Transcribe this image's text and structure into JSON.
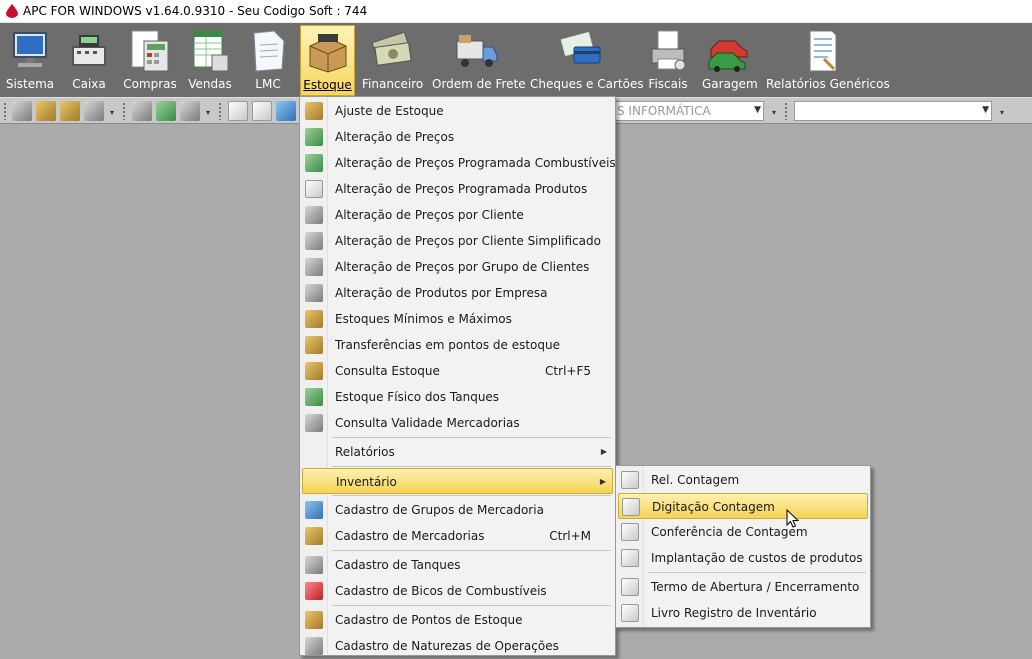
{
  "window": {
    "title": "APC FOR WINDOWS v1.64.0.9310 - Seu Codigo Soft : 744"
  },
  "menubar": {
    "items": [
      {
        "label": "Sistema",
        "icon": "monitor-icon"
      },
      {
        "label": "Caixa",
        "icon": "cash-register-icon"
      },
      {
        "label": "Compras",
        "icon": "calculator-icon"
      },
      {
        "label": "Vendas",
        "icon": "spreadsheet-icon"
      },
      {
        "label": "LMC",
        "icon": "document-icon"
      },
      {
        "label": "Estoque",
        "icon": "box-icon"
      },
      {
        "label": "Financeiro",
        "icon": "money-icon"
      },
      {
        "label": "Ordem de Frete",
        "icon": "truck-icon"
      },
      {
        "label": "Cheques e Cartões",
        "icon": "card-icon"
      },
      {
        "label": "Fiscais",
        "icon": "printer-icon"
      },
      {
        "label": "Garagem",
        "icon": "car-icon"
      },
      {
        "label": "Relatórios Genéricos",
        "icon": "report-icon"
      }
    ]
  },
  "toolbar2": {
    "combo1_text": "S INFORMÁTICA",
    "combo2_text": ""
  },
  "estoque_menu": {
    "items": [
      {
        "label": "Ajuste de Estoque",
        "shortcut": ""
      },
      {
        "label": "Alteração de Preços",
        "shortcut": ""
      },
      {
        "label": "Alteração de Preços Programada Combustíveis",
        "shortcut": ""
      },
      {
        "label": "Alteração de Preços Programada Produtos",
        "shortcut": ""
      },
      {
        "label": "Alteração de Preços por Cliente",
        "shortcut": ""
      },
      {
        "label": "Alteração de Preços por Cliente Simplificado",
        "shortcut": ""
      },
      {
        "label": "Alteração de Preços por Grupo de Clientes",
        "shortcut": ""
      },
      {
        "label": "Alteração de Produtos por Empresa",
        "shortcut": ""
      },
      {
        "label": "Estoques Mínimos e Máximos",
        "shortcut": ""
      },
      {
        "label": "Transferências em pontos de estoque",
        "shortcut": ""
      },
      {
        "label": "Consulta Estoque",
        "shortcut": "Ctrl+F5"
      },
      {
        "label": "Estoque Físico dos Tanques",
        "shortcut": ""
      },
      {
        "label": "Consulta Validade Mercadorias",
        "shortcut": ""
      },
      {
        "label": "Relatórios",
        "shortcut": ""
      },
      {
        "label": "Inventário",
        "shortcut": ""
      },
      {
        "label": "Cadastro de Grupos de Mercadoria",
        "shortcut": ""
      },
      {
        "label": "Cadastro de Mercadorias",
        "shortcut": "Ctrl+M"
      },
      {
        "label": "Cadastro de Tanques",
        "shortcut": ""
      },
      {
        "label": "Cadastro de Bicos de Combustíveis",
        "shortcut": ""
      },
      {
        "label": "Cadastro de Pontos de Estoque",
        "shortcut": ""
      },
      {
        "label": "Cadastro de Naturezas de Operações",
        "shortcut": ""
      }
    ]
  },
  "inventario_submenu": {
    "items": [
      {
        "label": "Rel. Contagem"
      },
      {
        "label": "Digitação Contagem"
      },
      {
        "label": "Conferência de Contagem"
      },
      {
        "label": "Implantação de custos de produtos"
      },
      {
        "label": "Termo de Abertura / Encerramento"
      },
      {
        "label": "Livro Registro de Inventário"
      }
    ]
  }
}
